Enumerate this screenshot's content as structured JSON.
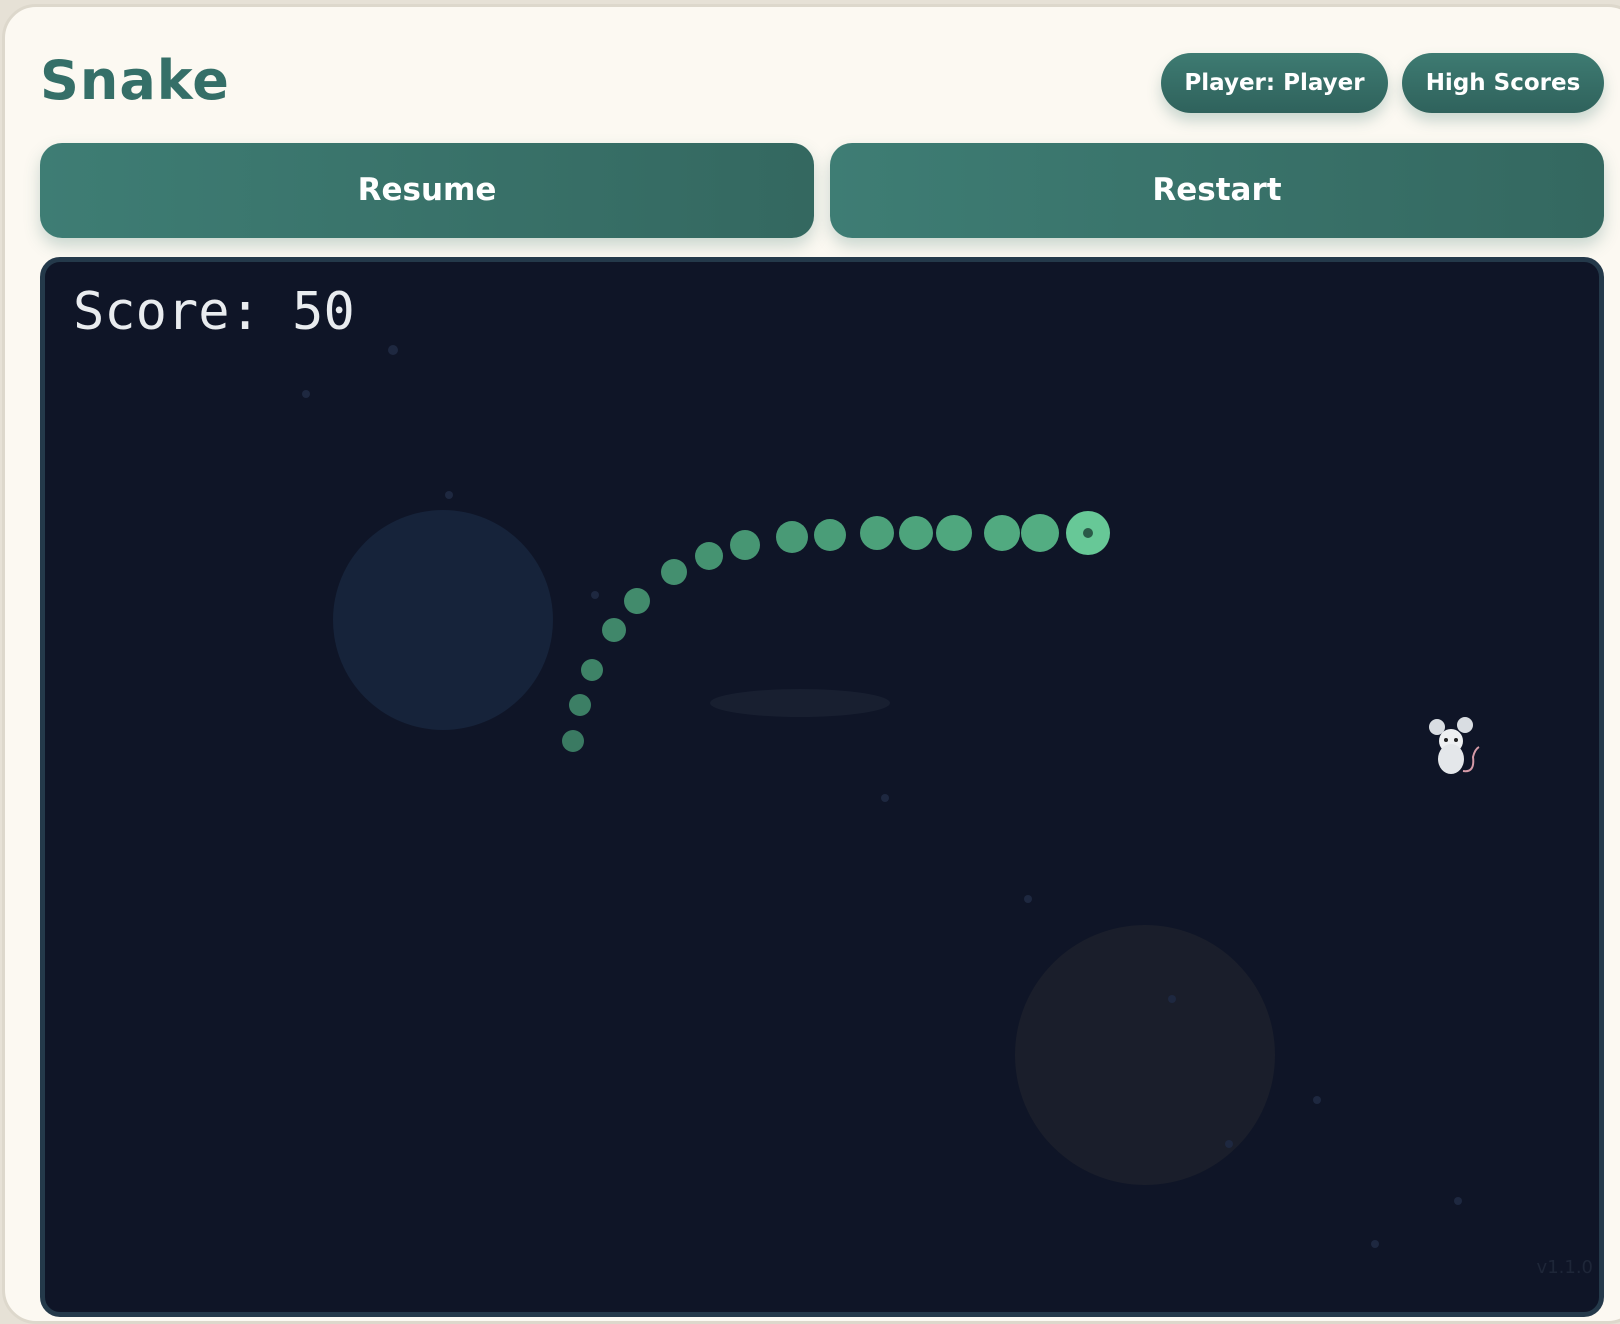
{
  "app": {
    "title": "Snake"
  },
  "header": {
    "player_label": "Player: Player",
    "high_scores_label": "High Scores"
  },
  "controls": {
    "resume_label": "Resume",
    "restart_label": "Restart"
  },
  "game": {
    "score_text": "Score: 50",
    "version_text": "v1.1.0",
    "colors": {
      "board_bg": "#0f1527",
      "board_border": "#24394a",
      "snake_body": "#4f9f7e",
      "snake_head": "#67c897",
      "accent": "#356f68"
    },
    "icons": [
      "mouse-icon"
    ]
  }
}
